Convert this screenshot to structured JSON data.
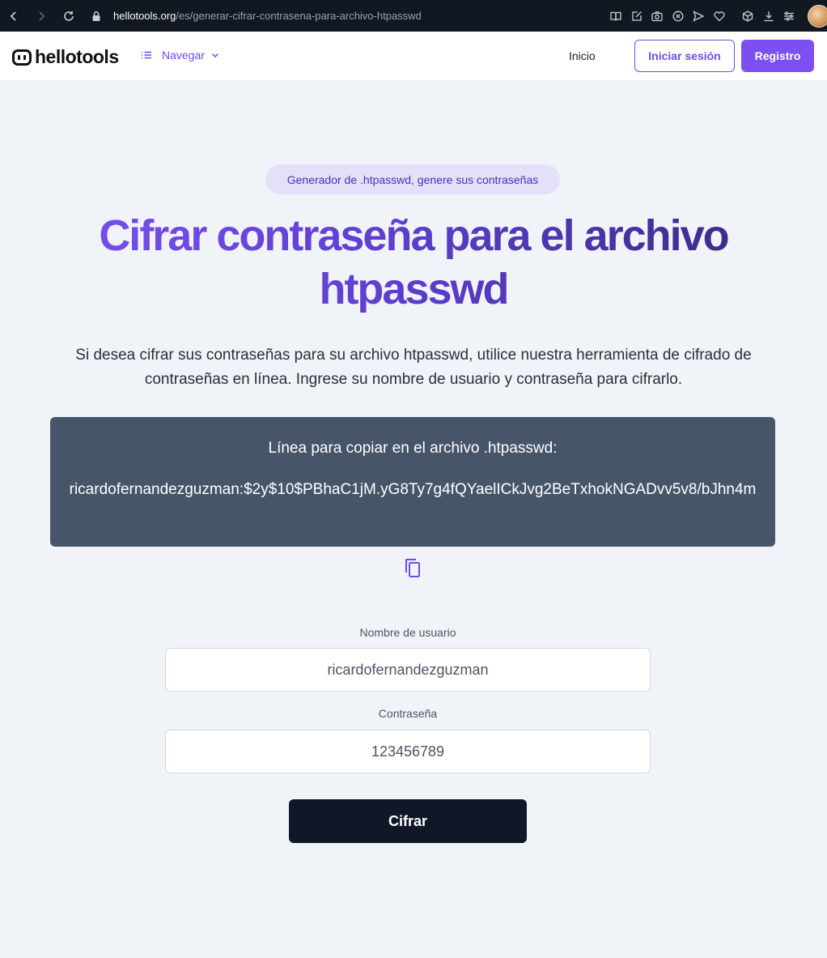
{
  "browser": {
    "url_host": "hellotools.org",
    "url_path": "/es/generar-cifrar-contrasena-para-archivo-htpasswd",
    "toolbar_icons": [
      "reader-icon",
      "edit-icon",
      "camera-icon",
      "block-icon",
      "send-icon",
      "heart-icon",
      "cube-icon",
      "download-icon",
      "settings-icon"
    ]
  },
  "header": {
    "logo_text": "hellotools",
    "nav_label": "Navegar",
    "home_link": "Inicio",
    "login_label": "Iniciar sesión",
    "register_label": "Registro"
  },
  "main": {
    "badge": "Generador de .htpasswd, genere sus contraseñas",
    "title": "Cifrar contraseña para el archivo htpasswd",
    "intro": "Si desea cifrar sus contraseñas para su archivo htpasswd, utilice nuestra herramienta de cifrado de contraseñas en línea. Ingrese su nombre de usuario y contraseña para cifrarlo.",
    "result_label": "Línea para copiar en el archivo .htpasswd:",
    "result_value": "ricardofernandezguzman:$2y$10$PBhaC1jM.yG8Ty7g4fQYaelICkJvg2BeTxhokNGADvv5v8/bJhn4m"
  },
  "form": {
    "username_label": "Nombre de usuario",
    "username_value": "ricardofernandezguzman",
    "password_label": "Contraseña",
    "password_value": "123456789",
    "submit_label": "Cifrar"
  },
  "colors": {
    "accent": "#7b4ff0",
    "result_bg": "#475569",
    "button_dark": "#101828",
    "page_bg": "#f0f3f8"
  }
}
